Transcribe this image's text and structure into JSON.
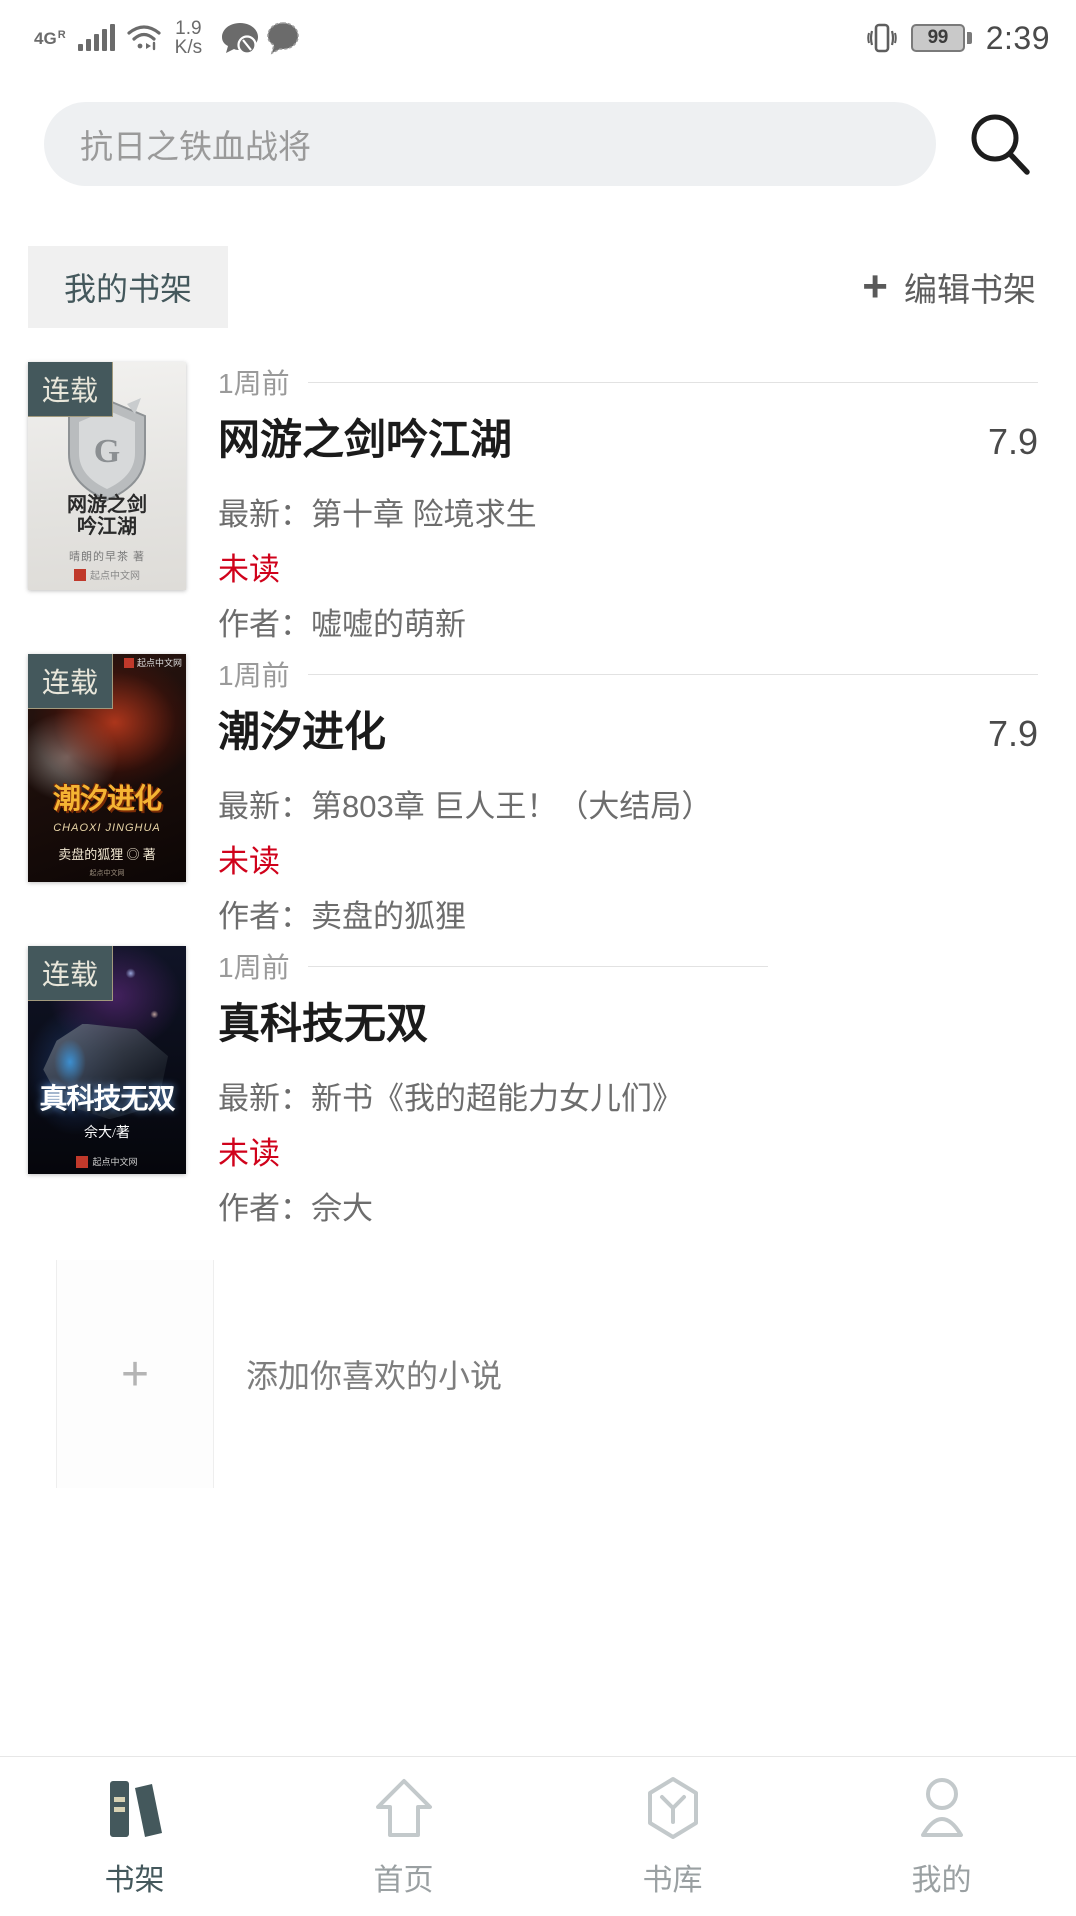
{
  "status_bar": {
    "network_type": "4G",
    "network_sup": "R",
    "speed_value": "1.9",
    "speed_unit": "K/s",
    "battery_percent": "99",
    "time": "2:39"
  },
  "search": {
    "placeholder": "抗日之铁血战将",
    "button_label": "search-icon"
  },
  "toolbar": {
    "shelf_tab_label": "我的书架",
    "edit_plus": "+",
    "edit_label": "编辑书架"
  },
  "books": [
    {
      "badge": "连载",
      "time_ago": "1周前",
      "title": "网游之剑吟江湖",
      "score": "7.9",
      "latest": "最新：第十章 险境求生",
      "unread": "未读",
      "author": "作者：嘘嘘的萌新",
      "cover_title_line1": "网游之剑",
      "cover_title_line2": "吟江湖",
      "cover_sub": "晴朗的早茶 著",
      "cover_publisher": "起点中文网"
    },
    {
      "badge": "连载",
      "time_ago": "1周前",
      "title": "潮汐进化",
      "score": "7.9",
      "latest": "最新：第803章 巨人王！（大结局）",
      "unread": "未读",
      "author": "作者：卖盘的狐狸",
      "cover_title_line1": "潮汐进化",
      "cover_sub": "CHAOXI JINGHUA",
      "cover_author": "卖盘的狐狸 ◎ 著",
      "cover_publisher": "起点中文网"
    },
    {
      "badge": "连载",
      "time_ago": "1周前",
      "title": "真科技无双",
      "score": "",
      "latest": "最新：新书《我的超能力女儿们》",
      "unread": "未读",
      "author": "作者：佘大",
      "cover_title_line1": "真科技无双",
      "cover_author": "佘大/著",
      "cover_publisher": "起点中文网"
    }
  ],
  "add_placeholder": {
    "plus": "+",
    "label": "添加你喜欢的小说"
  },
  "bottom_nav": {
    "items": [
      {
        "label": "书架",
        "icon": "books-icon",
        "active": true
      },
      {
        "label": "首页",
        "icon": "home-arrow-icon",
        "active": false
      },
      {
        "label": "书库",
        "icon": "library-hexagon-icon",
        "active": false
      },
      {
        "label": "我的",
        "icon": "person-icon",
        "active": false
      }
    ]
  },
  "colors": {
    "accent": "#44585c",
    "unread": "#d0021b",
    "muted": "#9a9a9a",
    "chip_bg": "#f0f0f0",
    "search_bg": "#eef0f2"
  }
}
